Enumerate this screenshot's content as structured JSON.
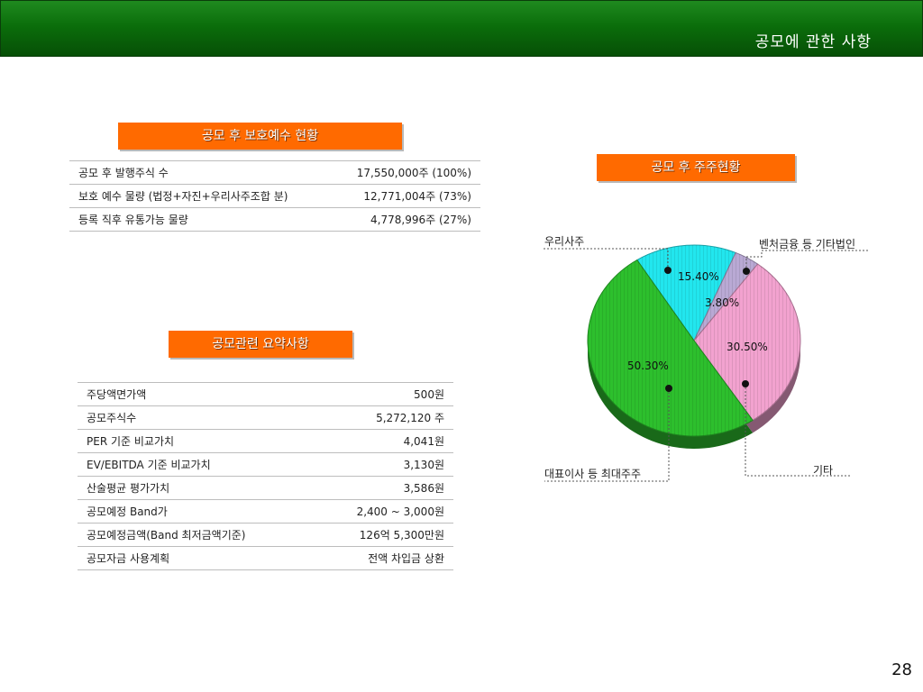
{
  "header": {
    "title": "공모에 관한 사항"
  },
  "lockup": {
    "title": "공모 후 보호예수 현황",
    "rows": [
      {
        "label": "공모 후 발행주식 수",
        "value": "17,550,000주 (100%)"
      },
      {
        "label": "보호 예수 물량 (법정+자진+우리사주조합 분)",
        "value": "12,771,004주   (73%)"
      },
      {
        "label": "등록 직후 유통가능 물량",
        "value": "4,778,996주   (27%)"
      }
    ]
  },
  "summary": {
    "title": "공모관련 요약사항",
    "rows": [
      {
        "label": "주당액면가액",
        "value": "500원"
      },
      {
        "label": "공모주식수",
        "value": "5,272,120 주"
      },
      {
        "label": "PER 기준 비교가치",
        "value": "4,041원"
      },
      {
        "label": "EV/EBITDA 기준 비교가치",
        "value": "3,130원"
      },
      {
        "label": "산술평균 평가가치",
        "value": "3,586원"
      },
      {
        "label": "공모예정 Band가",
        "value": "2,400 ~ 3,000원"
      },
      {
        "label": "공모예정금액(Band 최저금액기준)",
        "value": "126억 5,300만원"
      },
      {
        "label": "공모자금 사용계획",
        "value": "전액 차입금 상환"
      }
    ]
  },
  "shareholders": {
    "title": "공모 후 주주현황"
  },
  "chart_data": {
    "type": "pie",
    "title": "",
    "slices": [
      {
        "label": "우리사주",
        "value": 15.4,
        "display": "15.40%",
        "color": "#22e6ee"
      },
      {
        "label": "벤처금융 등 기타법인",
        "value": 3.8,
        "display": "3.80%",
        "color": "#b9a9d4"
      },
      {
        "label": "기타",
        "value": 30.5,
        "display": "30.50%",
        "color": "#f2a2cf"
      },
      {
        "label": "대표이사 등 최대주주",
        "value": 50.3,
        "display": "50.30%",
        "color": "#2dbf2d"
      }
    ]
  },
  "page": {
    "number": "28"
  }
}
